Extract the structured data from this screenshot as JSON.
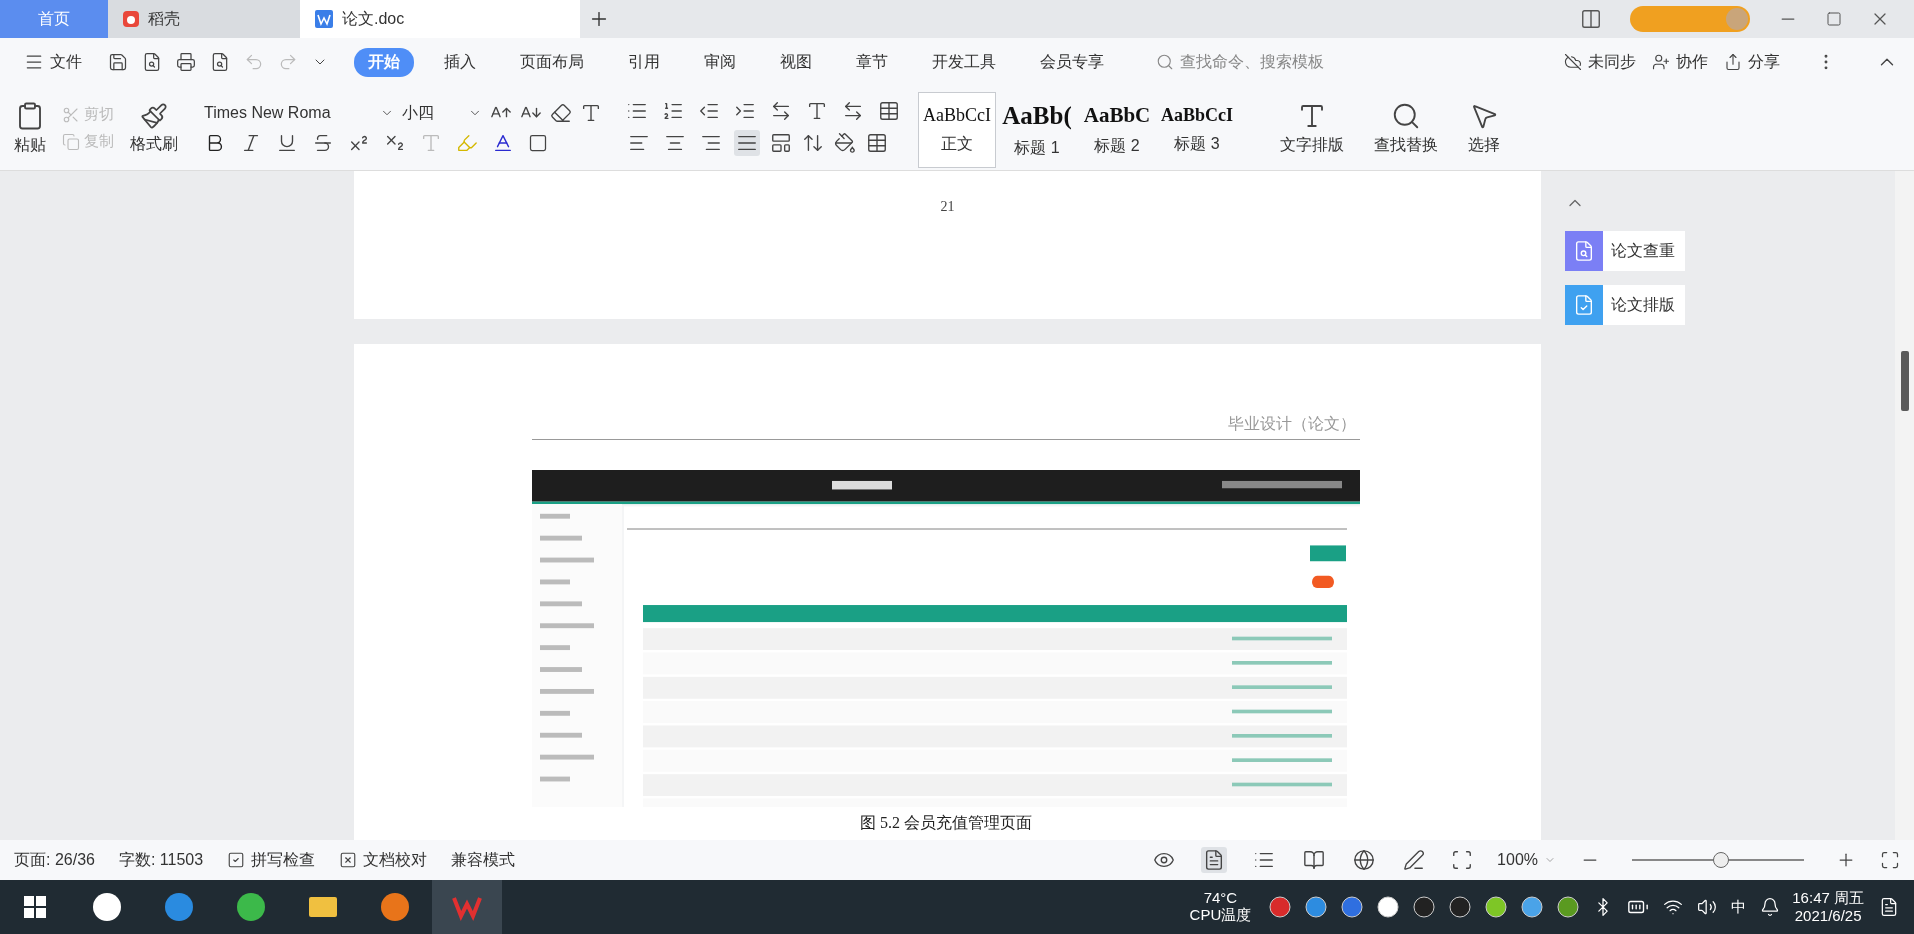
{
  "tabs": [
    {
      "label": "首页",
      "kind": "home",
      "selected": false
    },
    {
      "label": "稻壳",
      "kind": "docer",
      "selected": false
    },
    {
      "label": "论文.doc",
      "kind": "doc",
      "selected": true
    }
  ],
  "menu": {
    "file": "文件",
    "ribbon_tabs": [
      {
        "label": "开始",
        "selected": true
      },
      {
        "label": "插入",
        "selected": false
      },
      {
        "label": "页面布局",
        "selected": false
      },
      {
        "label": "引用",
        "selected": false
      },
      {
        "label": "审阅",
        "selected": false
      },
      {
        "label": "视图",
        "selected": false
      },
      {
        "label": "章节",
        "selected": false
      },
      {
        "label": "开发工具",
        "selected": false
      },
      {
        "label": "会员专享",
        "selected": false
      }
    ],
    "search": {
      "placeholder": "查找命令、搜索模板"
    },
    "actions": [
      {
        "label": "未同步",
        "kind": "sync"
      },
      {
        "label": "协作",
        "kind": "collab"
      },
      {
        "label": "分享",
        "kind": "share"
      }
    ]
  },
  "ribbon": {
    "paste": "粘贴",
    "cut": {
      "label": "剪切",
      "disabled": true
    },
    "copy": {
      "label": "复制",
      "disabled": true
    },
    "format_painter": "格式刷",
    "font": {
      "value": "Times New Roma"
    },
    "size": {
      "value": "小四"
    },
    "align": [
      {
        "kind": "left",
        "selected": false
      },
      {
        "kind": "center",
        "selected": false
      },
      {
        "kind": "right",
        "selected": false
      },
      {
        "kind": "justify",
        "selected": true
      }
    ],
    "styles": [
      {
        "preview": "AaBbCcI",
        "label": "正文",
        "kind": "normal",
        "selected": true
      },
      {
        "preview": "AaBb(",
        "label": "标题 1",
        "kind": "h1",
        "selected": false
      },
      {
        "preview": "AaBbC",
        "label": "标题 2",
        "kind": "h2",
        "selected": false
      },
      {
        "preview": "AaBbCcI",
        "label": "标题 3",
        "kind": "h3",
        "selected": false
      }
    ],
    "big_buttons": [
      {
        "label": "文字排版",
        "kind": "layout"
      },
      {
        "label": "查找替换",
        "kind": "find"
      },
      {
        "label": "选择",
        "kind": "select"
      }
    ]
  },
  "side_panel": [
    {
      "label": "论文查重",
      "kind": "check"
    },
    {
      "label": "论文排版",
      "kind": "format"
    }
  ],
  "document": {
    "page_number": "21",
    "header": "毕业设计（论文）",
    "caption": "图 5.2  会员充值管理页面"
  },
  "status_bar": {
    "page": "页面: 26/36",
    "words": "字数: 11503",
    "items": [
      {
        "label": "拼写检查",
        "kind": "check"
      },
      {
        "label": "文档校对",
        "kind": "cross"
      },
      {
        "label": "兼容模式",
        "kind": "plain"
      }
    ],
    "views": [
      {
        "kind": "eye",
        "selected": false
      },
      {
        "kind": "page",
        "selected": true
      },
      {
        "kind": "outline",
        "selected": false
      },
      {
        "kind": "read",
        "selected": false
      },
      {
        "kind": "web",
        "selected": false
      },
      {
        "kind": "pen",
        "selected": false
      }
    ],
    "zoom": "100%",
    "zoom_slider": {
      "level": 0.52
    }
  },
  "taskbar": {
    "temperature": "74°C",
    "temperature_label": "CPU温度",
    "ime": "中",
    "time": "16:47 周五",
    "date": "2021/6/25"
  }
}
